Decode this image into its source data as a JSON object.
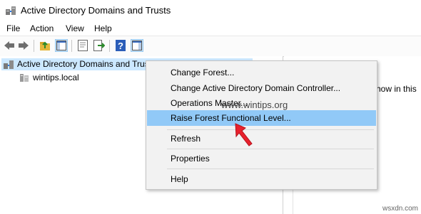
{
  "window": {
    "title": "Active Directory Domains and Trusts"
  },
  "menubar": {
    "file": "File",
    "action": "Action",
    "view": "View",
    "help": "Help"
  },
  "toolbar": {
    "icons": [
      "back-icon",
      "forward-icon",
      "up-folder-icon",
      "show-hide-tree-icon",
      "properties-icon",
      "export-icon",
      "help-icon",
      "show-action-pane-icon"
    ]
  },
  "tree": {
    "root_label": "Active Directory Domains and Trusts [Server2K16.wintips.local]",
    "child_label": "wintips.local"
  },
  "right_pane": {
    "text": "o show in this"
  },
  "context_menu": {
    "items": [
      "Change Forest...",
      "Change Active Directory Domain Controller...",
      "Operations Master...",
      "Raise Forest Functional Level...",
      "Refresh",
      "Properties",
      "Help"
    ],
    "highlighted_index": 3
  },
  "watermark": {
    "text": "www.wintips.org"
  },
  "corner": {
    "text": "wsxdn.com"
  },
  "colors": {
    "highlight": "#91c9f7",
    "tree_selected": "#cce8ff",
    "arrow": "#e8212d"
  }
}
